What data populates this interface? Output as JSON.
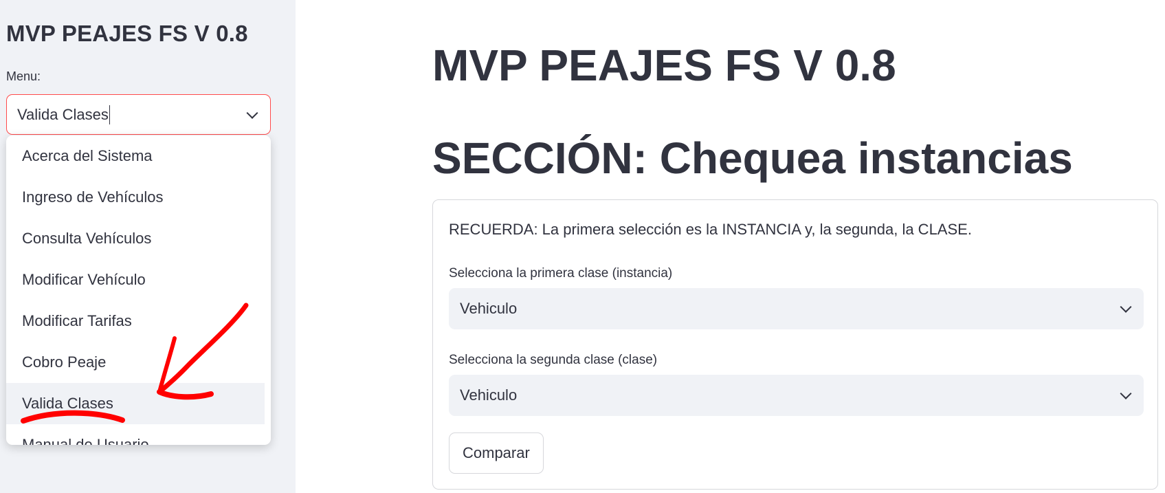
{
  "sidebar": {
    "title": "MVP PEAJES FS V 0.8",
    "menu_label": "Menu:",
    "select_value": "Valida Clases",
    "options": [
      "Acerca del Sistema",
      "Ingreso de Vehículos",
      "Consulta Vehículos",
      "Modificar Vehículo",
      "Modificar Tarifas",
      "Cobro Peaje",
      "Valida Clases",
      "Manual de Usuario"
    ],
    "selected_index": 6
  },
  "main": {
    "title": "MVP PEAJES FS V 0.8",
    "section_title": "SECCIÓN: Chequea instancias",
    "reminder": "RECUERDA: La primera selección es la INSTANCIA y, la segunda, la CLASE.",
    "first_label": "Selecciona la primera clase (instancia)",
    "first_value": "Vehiculo",
    "second_label": "Selecciona la segunda clase (clase)",
    "second_value": "Vehiculo",
    "compare_button": "Comparar"
  },
  "colors": {
    "accent": "#ff4b4b",
    "sidebar_bg": "#f0f2f6",
    "text": "#31333f",
    "annotation": "#ff0000"
  },
  "icons": [
    "chevron-down-icon"
  ]
}
